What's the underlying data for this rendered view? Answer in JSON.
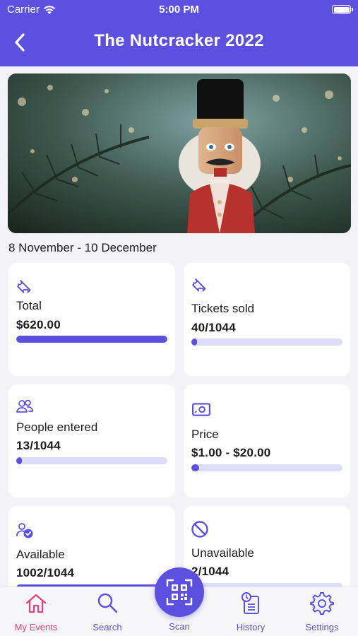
{
  "status_bar": {
    "carrier": "Carrier",
    "time": "5:00 PM"
  },
  "nav": {
    "title": "The Nutcracker 2022"
  },
  "event": {
    "date_range": "8 November - 10 December"
  },
  "stats": [
    {
      "icon": "ticket-icon",
      "label": "Total",
      "value": "$620.00",
      "progress": 1.0
    },
    {
      "icon": "ticket-icon",
      "label": "Tickets sold",
      "value": "40/1044",
      "progress": 0.038
    },
    {
      "icon": "people-icon",
      "label": "People entered",
      "value": "13/1044",
      "progress": 0.012
    },
    {
      "icon": "money-icon",
      "label": "Price",
      "value": "$1.00 - $20.00",
      "progress": 0.05
    },
    {
      "icon": "person-check-icon",
      "label": "Available",
      "value": "1002/1044",
      "progress": 0.96
    },
    {
      "icon": "block-icon",
      "label": "Unavailable",
      "value": "2/1044",
      "progress": 0.002
    }
  ],
  "tabs": [
    {
      "label": "My Events",
      "icon": "home-icon",
      "active": true
    },
    {
      "label": "Search",
      "icon": "search-icon",
      "active": false
    },
    {
      "label": "Scan",
      "icon": "qr-code-icon",
      "active": false
    },
    {
      "label": "History",
      "icon": "history-icon",
      "active": false
    },
    {
      "label": "Settings",
      "icon": "gear-icon",
      "active": false
    }
  ],
  "colors": {
    "accent": "#5b50e0",
    "active_tab": "#e8407a",
    "track": "#dedcfb"
  }
}
